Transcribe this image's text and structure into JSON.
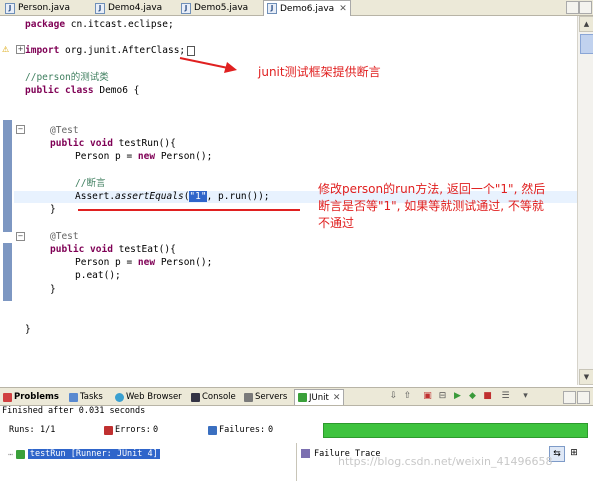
{
  "tabs": [
    {
      "label": "Person.java",
      "active": false
    },
    {
      "label": "Demo4.java",
      "active": false
    },
    {
      "label": "Demo5.java",
      "active": false
    },
    {
      "label": "Demo6.java",
      "active": true,
      "close": "✕"
    }
  ],
  "code": {
    "package_kw": "package",
    "package_rest": " cn.itcast.eclipse;",
    "import_kw": "import",
    "import_rest": " org.junit.AfterClass;",
    "comment_person": "//person的测试类",
    "class_kw": "public class",
    "class_rest": " Demo6 {",
    "annot1": "@Test",
    "m1_kw": "public void",
    "m1_rest": " testRun(){",
    "line_person1_a": "Person p = ",
    "new_kw": "new",
    "line_person1_b": " Person();",
    "comment_assert": "//断言",
    "assert_a": "Assert.",
    "assert_method": "assertEquals",
    "assert_b": "(",
    "assert_str": "\"1\"",
    "assert_c": ", p.run());",
    "brace_close": "}",
    "annot2": "@Test",
    "m2_kw": "public void",
    "m2_rest": " testEat(){",
    "line_person2_a": "Person p = ",
    "line_person2_b": " Person();",
    "eat_line": "p.eat();",
    "brace_m2": "}",
    "brace_class": "}"
  },
  "annotations": {
    "junit_note": "junit测试框架提供断言",
    "run_note_line1": "修改person的run方法, 返回一个\"1\", 然后",
    "run_note_line2": "断言是否等\"1\", 如果等就测试通过, 不等就",
    "run_note_line3": "不通过"
  },
  "panel": {
    "tabs": [
      {
        "label": "Problems",
        "bold": true
      },
      {
        "label": "Tasks"
      },
      {
        "label": "Web Browser"
      },
      {
        "label": "Console"
      },
      {
        "label": "Servers"
      },
      {
        "label": "JUnit",
        "active": true,
        "close": "✕"
      }
    ],
    "status_text": "Finished after 0.031 seconds",
    "runs_label": "Runs:",
    "runs_value": "1/1",
    "errors_label": "Errors:",
    "errors_value": "0",
    "failures_label": "Failures:",
    "failures_value": "0",
    "progress_status": "green",
    "tree_item": "testRun [Runner: JUnit 4]",
    "failure_trace_label": "Failure Trace"
  },
  "watermark": "https://blog.csdn.net/weixin_41496658",
  "colors": {
    "annotation": "#e02020",
    "progress": "#3ec33e",
    "selection": "#2f65ca"
  }
}
